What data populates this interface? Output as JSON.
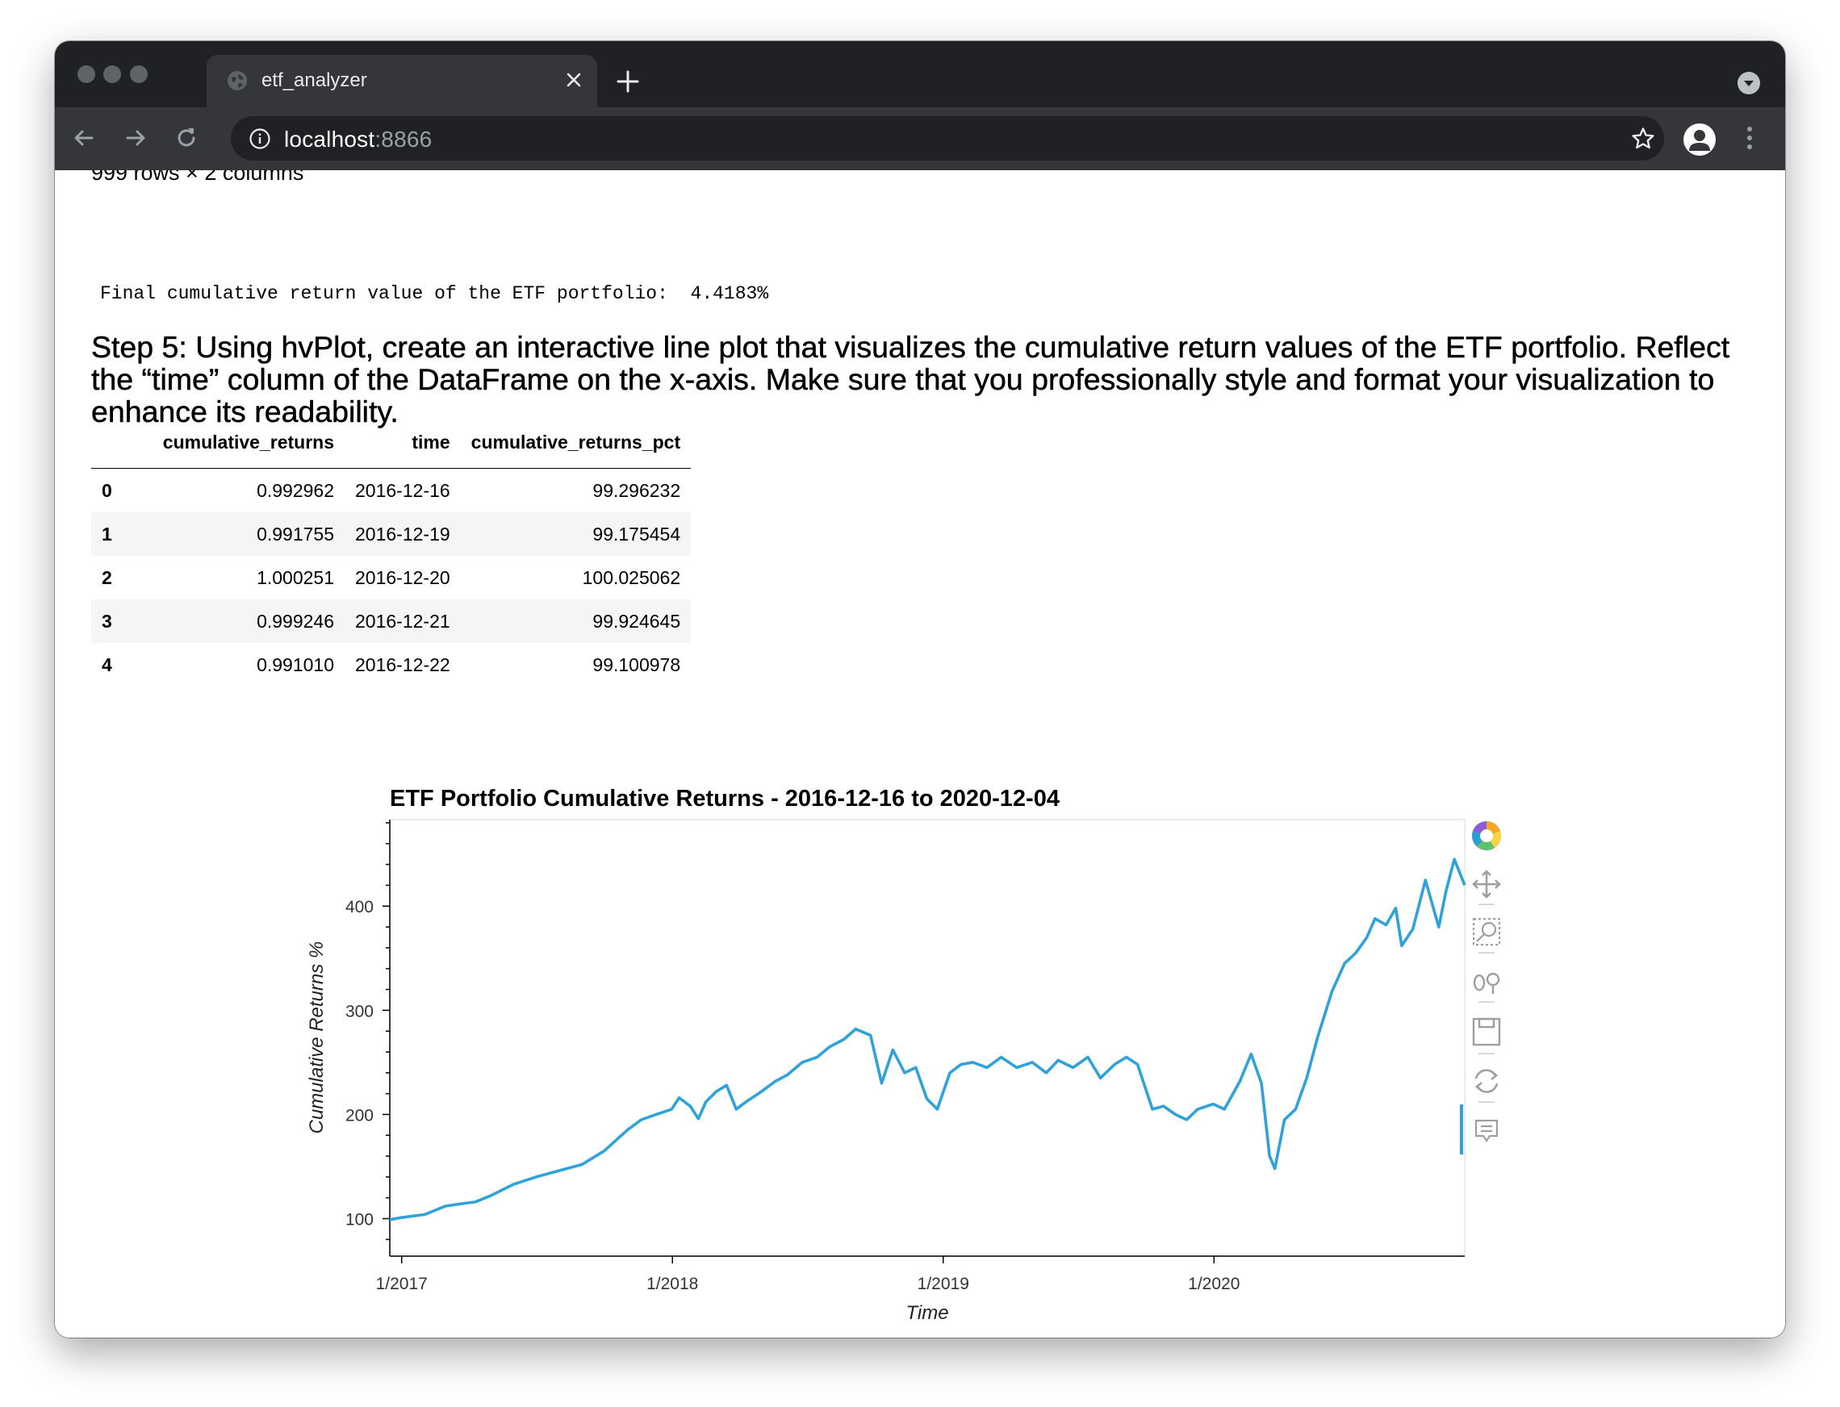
{
  "browser": {
    "tab_title": "etf_analyzer",
    "url_host": "localhost",
    "url_port": ":8866"
  },
  "page": {
    "cut_text": "999 rows × 2 columns",
    "final_output": "Final cumulative return value of the ETF portfolio:  4.4183%",
    "step_heading": "Step 5: Using hvPlot, create an interactive line plot that visualizes the cumulative return values of the ETF portfolio. Reflect the “time” column of the DataFrame on the x-axis. Make sure that you professionally style and format your visualization to enhance its readability."
  },
  "table": {
    "columns": [
      "",
      "cumulative_returns",
      "time",
      "cumulative_returns_pct"
    ],
    "rows": [
      [
        "0",
        "0.992962",
        "2016-12-16",
        "99.296232"
      ],
      [
        "1",
        "0.991755",
        "2016-12-19",
        "99.175454"
      ],
      [
        "2",
        "1.000251",
        "2016-12-20",
        "100.025062"
      ],
      [
        "3",
        "0.999246",
        "2016-12-21",
        "99.924645"
      ],
      [
        "4",
        "0.991010",
        "2016-12-22",
        "99.100978"
      ]
    ]
  },
  "chart_data": {
    "type": "line",
    "title": "ETF Portfolio Cumulative Returns - 2016-12-16 to 2020-12-04",
    "xlabel": "Time",
    "ylabel": "Cumulative Returns %",
    "xlim": [
      "2016-12-16",
      "2020-12-04"
    ],
    "ylim": [
      64,
      483
    ],
    "x_ticks": [
      {
        "date": "2017-01-01",
        "label": "1/2017"
      },
      {
        "date": "2018-01-01",
        "label": "1/2018"
      },
      {
        "date": "2019-01-01",
        "label": "1/2019"
      },
      {
        "date": "2020-01-01",
        "label": "1/2020"
      }
    ],
    "y_ticks": [
      100,
      200,
      300,
      400
    ],
    "grid": false,
    "line_color": "#30a2da",
    "series": [
      {
        "x": [
          "2016-12-16",
          "2017-01-01",
          "2017-02-01",
          "2017-03-01",
          "2017-03-20",
          "2017-04-10",
          "2017-05-01",
          "2017-06-01",
          "2017-07-01",
          "2017-08-01",
          "2017-09-01",
          "2017-10-01",
          "2017-11-01",
          "2017-11-20",
          "2017-12-10",
          "2017-12-31",
          "2018-01-10",
          "2018-01-25",
          "2018-02-05",
          "2018-02-15",
          "2018-03-01",
          "2018-03-15",
          "2018-03-28",
          "2018-04-10",
          "2018-05-01",
          "2018-05-20",
          "2018-06-05",
          "2018-06-25",
          "2018-07-15",
          "2018-08-01",
          "2018-08-20",
          "2018-09-05",
          "2018-09-25",
          "2018-10-10",
          "2018-10-25",
          "2018-11-10",
          "2018-11-25",
          "2018-12-10",
          "2018-12-24",
          "2019-01-10",
          "2019-01-25",
          "2019-02-10",
          "2019-03-01",
          "2019-03-20",
          "2019-04-10",
          "2019-05-01",
          "2019-05-20",
          "2019-06-05",
          "2019-06-25",
          "2019-07-15",
          "2019-08-01",
          "2019-08-20",
          "2019-09-05",
          "2019-09-20",
          "2019-10-10",
          "2019-10-25",
          "2019-11-10",
          "2019-11-25",
          "2019-12-10",
          "2019-12-31",
          "2020-01-15",
          "2020-02-05",
          "2020-02-20",
          "2020-03-05",
          "2020-03-16",
          "2020-03-23",
          "2020-04-05",
          "2020-04-20",
          "2020-05-05",
          "2020-05-20",
          "2020-06-08",
          "2020-06-25",
          "2020-07-10",
          "2020-07-25",
          "2020-08-05",
          "2020-08-20",
          "2020-09-02",
          "2020-09-10",
          "2020-09-25",
          "2020-10-12",
          "2020-10-30",
          "2020-11-09",
          "2020-11-20",
          "2020-12-04"
        ],
        "y": [
          99,
          101,
          104,
          112,
          114,
          116,
          122,
          133,
          140,
          146,
          152,
          165,
          185,
          195,
          200,
          205,
          216,
          208,
          196,
          212,
          222,
          228,
          205,
          212,
          222,
          232,
          238,
          250,
          255,
          265,
          272,
          282,
          276,
          230,
          262,
          240,
          245,
          215,
          205,
          240,
          248,
          250,
          245,
          255,
          245,
          250,
          240,
          252,
          245,
          255,
          235,
          248,
          255,
          248,
          205,
          208,
          200,
          195,
          205,
          210,
          205,
          232,
          258,
          230,
          160,
          148,
          195,
          205,
          235,
          275,
          318,
          345,
          355,
          370,
          388,
          382,
          398,
          362,
          378,
          425,
          380,
          415,
          445,
          420
        ]
      }
    ]
  }
}
